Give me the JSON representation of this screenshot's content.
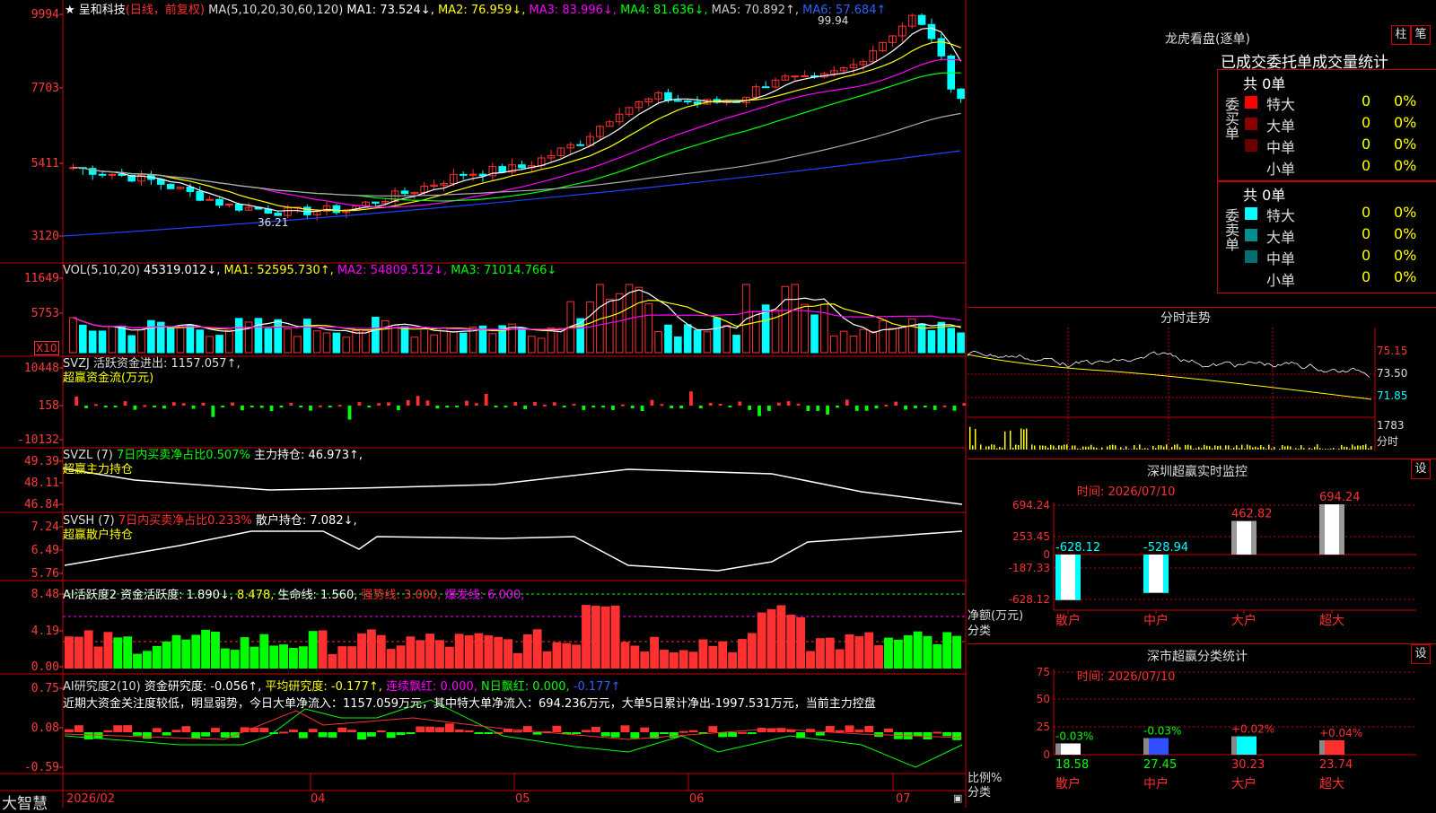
{
  "app": {
    "name": "大智慧"
  },
  "main_header": {
    "star": "★",
    "name": "呈和科技",
    "period": "(日线，前复权)",
    "ma": "MA(5,10,20,30,60,120)",
    "ma1": "MA1: 73.524↓,",
    "ma2": "MA2: 76.959↓,",
    "ma3": "MA3: 83.996↓,",
    "ma4": "MA4: 81.636↓,",
    "ma5": "MA5: 70.892↑,",
    "ma6": "MA6: 57.684↑"
  },
  "vol_header": {
    "a": "VOL(5,10,20)",
    "b": "45319.012↓,",
    "c": "MA1: 52595.730↑,",
    "d": "MA2: 54809.512↓,",
    "e": "MA3: 71014.766↓"
  },
  "svzj": {
    "a": "SVZJ  活跃资金进出: 1157.057↑,",
    "b": "超赢资金流(万元)"
  },
  "svzl": {
    "a": "SVZL (7)",
    "b": "7日内买卖净占比0.507%",
    "c": "主力持仓: 46.973↑,",
    "d": "超赢主力持仓"
  },
  "svsh": {
    "a": "SVSH (7)",
    "b": "7日内买卖净占比0.233%",
    "c": "散户持仓: 7.082↓,",
    "d": "超赢散户持仓"
  },
  "ai2": {
    "a": "AI活跃度2 资金活跃度: 1.890↓,",
    "b": "8.478,",
    "c": "生命线: 1.560,",
    "d": "强势线: 3.000,",
    "e": "爆发线: 6.000,"
  },
  "ai_res": {
    "a": "AI研究度2(10)",
    "b": "资金研究度: -0.056↑,",
    "c": "平均研究度: -0.177↑,",
    "d": "连续飘红: 0.000,",
    "e": "N日飘红: 0.000,",
    "f": "-0.177↑",
    "text": "近期大资金关注度较低，明显弱势，今日大单净流入：1157.059万元，其中特大单净流入：694.236万元，大单5日累计净出-1997.531万元，当前主力控盘"
  },
  "axes": {
    "price": [
      "9994",
      "7703",
      "5411",
      "3120"
    ],
    "vol": [
      "11649",
      "5753"
    ],
    "vol_mult": "X10",
    "svzj": [
      "10448",
      "158",
      "-10132"
    ],
    "svzl": [
      "49.39",
      "48.11",
      "46.84"
    ],
    "svsh": [
      "7.24",
      "6.49",
      "5.76"
    ],
    "ai2": [
      "8.48",
      "4.19",
      "0.00"
    ],
    "res": [
      "0.75",
      "0.08",
      "-0.59"
    ]
  },
  "annotations": {
    "high": "99.94",
    "low": "36.21"
  },
  "xaxis": [
    "2026/02",
    "04",
    "05",
    "06",
    "07"
  ],
  "lhkp": {
    "title": "龙虎看盘(逐单)",
    "btn_bar": "柱",
    "btn_pen": "笔",
    "header": "已成交委托单成交量统计",
    "buy_label": "委买单",
    "sell_label": "委卖单",
    "buy_total": "共 0单",
    "sell_total": "共 0单",
    "buy": [
      {
        "name": "特大",
        "count": "0",
        "pct": "0%",
        "color": "#ff0000"
      },
      {
        "name": "大单",
        "count": "0",
        "pct": "0%",
        "color": "#8b0000"
      },
      {
        "name": "中单",
        "count": "0",
        "pct": "0%",
        "color": "#6b0000"
      },
      {
        "name": "小单",
        "count": "0",
        "pct": "0%",
        "color": "#000000"
      }
    ],
    "sell": [
      {
        "name": "特大",
        "count": "0",
        "pct": "0%",
        "color": "#00ffff"
      },
      {
        "name": "大单",
        "count": "0",
        "pct": "0%",
        "color": "#009090"
      },
      {
        "name": "中单",
        "count": "0",
        "pct": "0%",
        "color": "#007070"
      },
      {
        "name": "小单",
        "count": "0",
        "pct": "0%",
        "color": "#000000"
      }
    ]
  },
  "fenshi": {
    "title": "分时走势",
    "ylabels": [
      "75.15",
      "73.50",
      "71.85"
    ],
    "vol_label": "1783",
    "unit": "分时"
  },
  "monitor": {
    "title": "深圳超赢实时监控",
    "btn": "设",
    "date": "时间: 2026/07/10",
    "ylabels": [
      "694.24",
      "253.45",
      "0",
      "-187.33",
      "-628.12"
    ],
    "ytitle": "净额(万元)",
    "xtitle": "分类",
    "bars": [
      {
        "cat": "散户",
        "value": -628.12,
        "label": "-628.12"
      },
      {
        "cat": "中户",
        "value": -528.94,
        "label": "-528.94"
      },
      {
        "cat": "大户",
        "value": 462.82,
        "label": "462.82"
      },
      {
        "cat": "超大",
        "value": 694.24,
        "label": "694.24"
      }
    ]
  },
  "stats": {
    "title": "深市超赢分类统计",
    "btn": "设",
    "date": "时间: 2026/07/10",
    "ylabels": [
      "75",
      "50",
      "25",
      "0"
    ],
    "ytitle": "比例%",
    "xtitle": "分类",
    "bars": [
      {
        "cat": "散户",
        "value": 18.58,
        "label": "18.58",
        "change": "-0.03%",
        "color": "#ffffff",
        "labcolor": "#00ff00"
      },
      {
        "cat": "中户",
        "value": 27.45,
        "label": "27.45",
        "change": "-0.03%",
        "color": "#3050ff",
        "labcolor": "#00ff00"
      },
      {
        "cat": "大户",
        "value": 30.23,
        "label": "30.23",
        "change": "+0.02%",
        "color": "#00ffff",
        "labcolor": "#ff3030"
      },
      {
        "cat": "超大",
        "value": 23.74,
        "label": "23.74",
        "change": "+0.04%",
        "color": "#ff3030",
        "labcolor": "#ff3030"
      }
    ]
  }
}
